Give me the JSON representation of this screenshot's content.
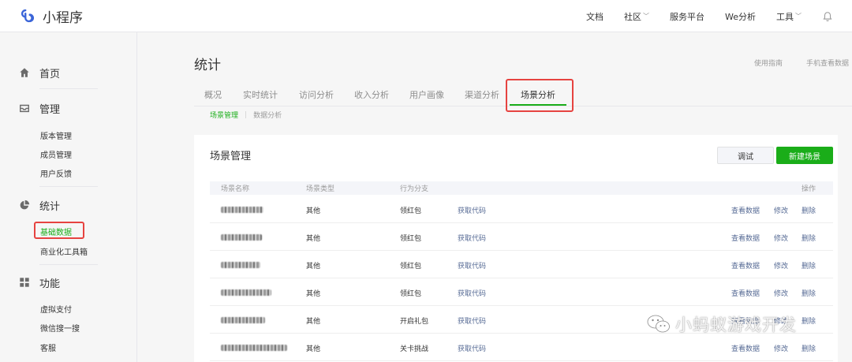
{
  "header": {
    "app_name": "小程序",
    "nav": [
      {
        "label": "文档",
        "dropdown": false
      },
      {
        "label": "社区",
        "dropdown": true
      },
      {
        "label": "服务平台",
        "dropdown": false
      },
      {
        "label": "We分析",
        "dropdown": false
      },
      {
        "label": "工具",
        "dropdown": true
      }
    ],
    "bell_icon": "bell-icon"
  },
  "sidebar": {
    "groups": [
      {
        "icon": "home-icon",
        "label": "首页",
        "items": []
      },
      {
        "icon": "inbox-icon",
        "label": "管理",
        "items": [
          "版本管理",
          "成员管理",
          "用户反馈"
        ]
      },
      {
        "icon": "pie-chart-icon",
        "label": "统计",
        "items": [
          "基础数据",
          "商业化工具箱"
        ],
        "active_item": "基础数据"
      },
      {
        "icon": "grid-icon",
        "label": "功能",
        "items": [
          "虚拟支付",
          "微信搜一搜",
          "客服"
        ]
      }
    ]
  },
  "main": {
    "title": "统计",
    "top_links": [
      "使用指南",
      "手机查看数据"
    ],
    "tabs": [
      "概况",
      "实时统计",
      "访问分析",
      "收入分析",
      "用户画像",
      "渠道分析",
      "场景分析"
    ],
    "active_tab": "场景分析",
    "subtabs": [
      "场景管理",
      "数据分析"
    ],
    "active_subtab": "场景管理"
  },
  "card": {
    "title": "场景管理",
    "debug_button": "调试",
    "new_button": "新建场景",
    "columns": [
      "场景名称",
      "场景类型",
      "行为分支",
      "操作"
    ],
    "rows": [
      {
        "name": "",
        "type": "其他",
        "branch": "领红包",
        "code": "获取代码",
        "actions": [
          "查看数据",
          "修改",
          "删除"
        ]
      },
      {
        "name": "",
        "type": "其他",
        "branch": "领红包",
        "code": "获取代码",
        "actions": [
          "查看数据",
          "修改",
          "删除"
        ]
      },
      {
        "name": "",
        "type": "其他",
        "branch": "领红包",
        "code": "获取代码",
        "actions": [
          "查看数据",
          "修改",
          "删除"
        ]
      },
      {
        "name": "",
        "type": "其他",
        "branch": "领红包",
        "code": "获取代码",
        "actions": [
          "查看数据",
          "修改",
          "删除"
        ]
      },
      {
        "name": "",
        "type": "其他",
        "branch": "开启礼包",
        "code": "获取代码",
        "actions": [
          "查看数据",
          "修改",
          "删除"
        ]
      },
      {
        "name": "",
        "type": "其他",
        "branch": "关卡挑战",
        "code": "获取代码",
        "actions": [
          "查看数据",
          "修改",
          "删除"
        ]
      }
    ]
  },
  "watermark": {
    "text": "小蚂蚁游戏开发",
    "icon": "wechat-icon"
  },
  "colors": {
    "accent": "#1aad19",
    "link": "#576b95",
    "highlight_box": "#e64340"
  }
}
